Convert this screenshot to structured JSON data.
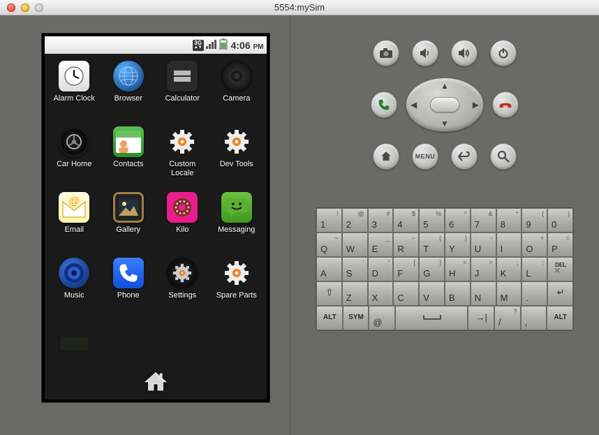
{
  "window": {
    "title": "5554:mySim"
  },
  "statusbar": {
    "network": "3G",
    "time": "4:06",
    "ampm": "PM"
  },
  "apps": [
    {
      "label": "Alarm Clock",
      "icon": "clock"
    },
    {
      "label": "Browser",
      "icon": "browser"
    },
    {
      "label": "Calculator",
      "icon": "calc"
    },
    {
      "label": "Camera",
      "icon": "camera"
    },
    {
      "label": "Car Home",
      "icon": "carhome"
    },
    {
      "label": "Contacts",
      "icon": "contacts"
    },
    {
      "label": "Custom Locale",
      "icon": "gear"
    },
    {
      "label": "Dev Tools",
      "icon": "gear"
    },
    {
      "label": "Email",
      "icon": "email"
    },
    {
      "label": "Gallery",
      "icon": "gallery"
    },
    {
      "label": "Kilo",
      "icon": "kilo"
    },
    {
      "label": "Messaging",
      "icon": "messaging"
    },
    {
      "label": "Music",
      "icon": "music"
    },
    {
      "label": "Phone",
      "icon": "phone"
    },
    {
      "label": "Settings",
      "icon": "settings"
    },
    {
      "label": "Spare Parts",
      "icon": "gear"
    }
  ],
  "hw_buttons": {
    "row1": [
      "camera-icon",
      "volume-down-icon",
      "volume-up-icon",
      "power-icon"
    ],
    "row3": [
      "home-icon",
      "menu-label",
      "back-icon",
      "search-icon"
    ],
    "menu_label": "MENU"
  },
  "keyboard": {
    "row1": [
      {
        "main": "1",
        "sup": "!"
      },
      {
        "main": "2",
        "sup": "@"
      },
      {
        "main": "3",
        "sup": "#"
      },
      {
        "main": "4",
        "sup": "$"
      },
      {
        "main": "5",
        "sup": "%"
      },
      {
        "main": "6",
        "sup": "^"
      },
      {
        "main": "7",
        "sup": "&"
      },
      {
        "main": "8",
        "sup": "*"
      },
      {
        "main": "9",
        "sup": "("
      },
      {
        "main": "0",
        "sup": ")"
      }
    ],
    "row2": [
      {
        "main": "Q",
        "sup": "~"
      },
      {
        "main": "W",
        "sup": "`"
      },
      {
        "main": "E",
        "sup": "_"
      },
      {
        "main": "R",
        "sup": "−"
      },
      {
        "main": "T",
        "sup": "{"
      },
      {
        "main": "Y",
        "sup": "}"
      },
      {
        "main": "U",
        "sup": "-"
      },
      {
        "main": "I",
        "sup": ""
      },
      {
        "main": "O",
        "sup": "+"
      },
      {
        "main": "P",
        "sup": "="
      }
    ],
    "row3": [
      {
        "main": "A",
        "sup": ""
      },
      {
        "main": "S",
        "sup": "'"
      },
      {
        "main": "D",
        "sup": "\""
      },
      {
        "main": "F",
        "sup": "["
      },
      {
        "main": "G",
        "sup": "]"
      },
      {
        "main": "H",
        "sup": "<"
      },
      {
        "main": "J",
        "sup": ">"
      },
      {
        "main": "K",
        "sup": ";"
      },
      {
        "main": "L",
        "sup": ":"
      },
      {
        "main": "DEL",
        "sup": ""
      }
    ],
    "row4": [
      {
        "main": "⇧",
        "sup": ""
      },
      {
        "main": "Z",
        "sup": ""
      },
      {
        "main": "X",
        "sup": ""
      },
      {
        "main": "C",
        "sup": ""
      },
      {
        "main": "V",
        "sup": ""
      },
      {
        "main": "B",
        "sup": ""
      },
      {
        "main": "N",
        "sup": ""
      },
      {
        "main": "M",
        "sup": ""
      },
      {
        "main": ".",
        "sup": ""
      },
      {
        "main": "↵",
        "sup": ""
      }
    ],
    "row5": [
      {
        "main": "ALT"
      },
      {
        "main": "SYM"
      },
      {
        "main": "@"
      },
      {
        "main": "space"
      },
      {
        "main": "→|"
      },
      {
        "main": "/",
        "sup": "?"
      },
      {
        "main": ",",
        "sup": ""
      },
      {
        "main": "ALT"
      }
    ]
  }
}
